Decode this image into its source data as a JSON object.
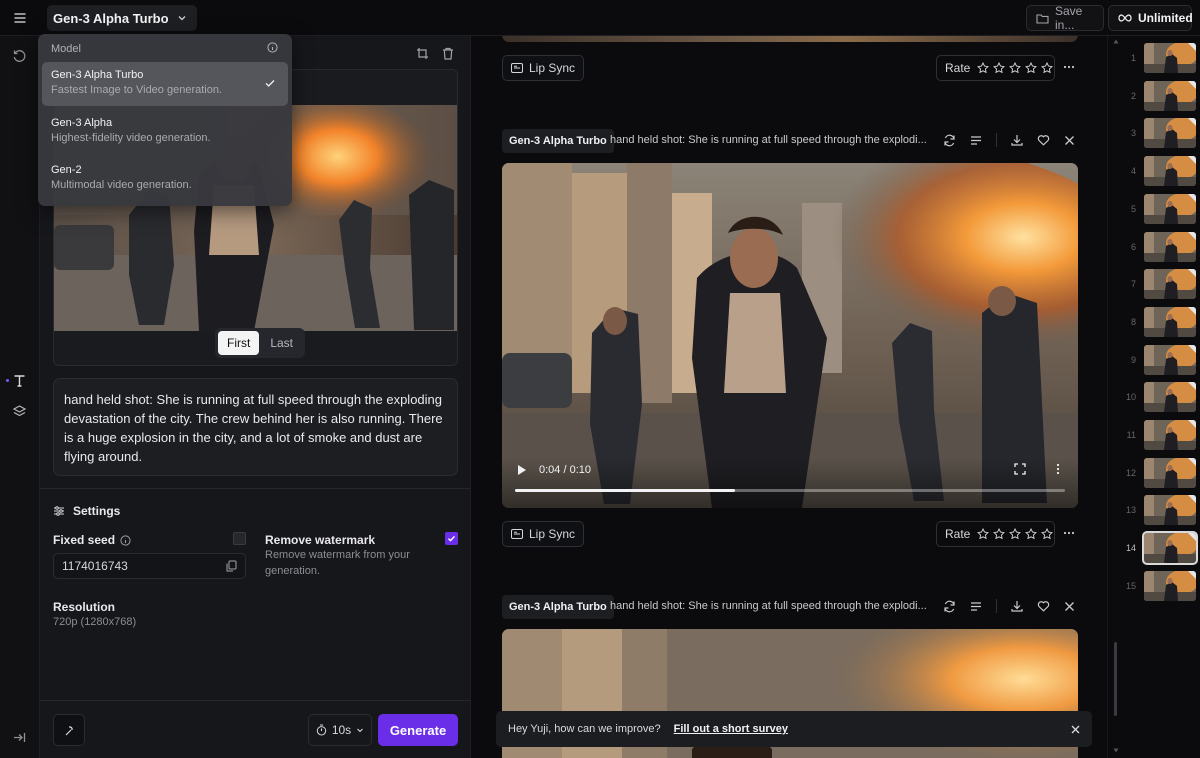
{
  "topbar": {
    "model_label": "Gen-3 Alpha Turbo",
    "save_label": "Save in...",
    "unlimited_label": "Unlimited"
  },
  "dropdown": {
    "header": "Model",
    "items": [
      {
        "title": "Gen-3 Alpha Turbo",
        "desc": "Fastest Image to Video generation.",
        "selected": true
      },
      {
        "title": "Gen-3 Alpha",
        "desc": "Highest-fidelity video generation."
      },
      {
        "title": "Gen-2",
        "desc": "Multimodal video generation."
      }
    ]
  },
  "left": {
    "frame_tabs": [
      "First",
      "Last"
    ],
    "prompt": "hand held shot: She is running at full speed through the exploding devastation of the city. The crew behind her is also running. There is a huge explosion in the city, and a lot of smoke and dust are flying around.",
    "settings_label": "Settings",
    "fixed_seed_label": "Fixed seed",
    "seed_value": "1174016743",
    "remove_watermark_label": "Remove watermark",
    "remove_watermark_desc": "Remove watermark from your generation.",
    "resolution_label": "Resolution",
    "resolution_value": "720p (1280x768)",
    "duration": "10s",
    "generate_label": "Generate"
  },
  "feed": {
    "lip_sync_label": "Lip Sync",
    "rate_label": "Rate",
    "model_tag": "Gen-3 Alpha Turbo",
    "prompt_preview": "hand held shot: She is running at full speed through the explodi...",
    "video_time": "0:04 / 0:10",
    "video_progress": 0.4,
    "survey_text": "Hey Yuji, how can we improve?",
    "survey_link": "Fill out a short survey"
  },
  "thumbnails": {
    "numbers": [
      "1",
      "2",
      "3",
      "4",
      "5",
      "6",
      "7",
      "8",
      "9",
      "10",
      "11",
      "12",
      "13",
      "14",
      "15"
    ],
    "current": "14"
  },
  "colors": {
    "accent": "#6a2ee8",
    "background": "#0b0b0d",
    "panel": "#16171b"
  }
}
